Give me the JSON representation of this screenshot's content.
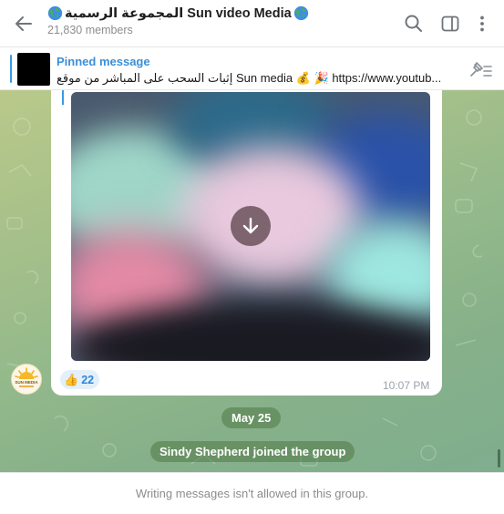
{
  "header": {
    "title_emoji_left": "globe-icon",
    "title": "المجموعة الرسمية Sun video Media",
    "title_emoji_right": "globe-icon",
    "members": "21,830 members",
    "icons": [
      "back-arrow-icon",
      "search-icon",
      "sidebar-toggle-icon",
      "more-vert-icon"
    ]
  },
  "pinned": {
    "label": "Pinned message",
    "text": "إثبات السحب على المباشر من موقع Sun media 💰 🎉  https://www.youtub...",
    "icon": "unpin-icon"
  },
  "message": {
    "media_action_icon": "download-arrow-icon",
    "reaction_emoji": "👍",
    "reaction_count": "22",
    "time": "10:07 PM",
    "avatar_text": "SUN MEDIA"
  },
  "date_separator": "May 25",
  "service_message": "Sindy Shepherd joined the group",
  "footer": {
    "text": "Writing messages isn't allowed in this group."
  },
  "colors": {
    "accent": "#3a8fd9",
    "chat_bg": "#93b98b",
    "reaction_bg": "#e3f0fb"
  }
}
